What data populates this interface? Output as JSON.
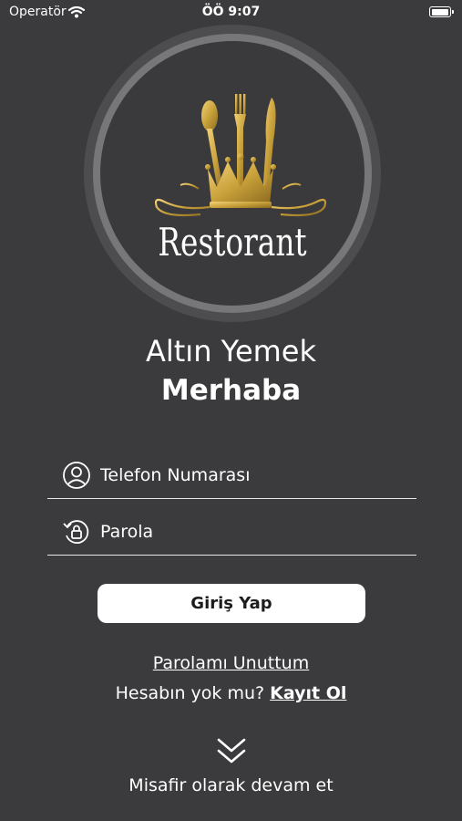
{
  "status_bar": {
    "carrier": "Operatör",
    "time": "ÖÖ 9:07",
    "battery_level": 0.95
  },
  "logo": {
    "word": "Restorant",
    "icon": "crown-cutlery-logo",
    "accent_color": "#c9a13a"
  },
  "header": {
    "app_name": "Altın Yemek",
    "greeting": "Merhaba"
  },
  "form": {
    "phone": {
      "placeholder": "Telefon Numarası",
      "value": "",
      "icon": "user-icon"
    },
    "password": {
      "placeholder": "Parola",
      "value": "",
      "icon": "lock-rotate-icon"
    },
    "login_label": "Giriş Yap"
  },
  "links": {
    "forgot_password": "Parolamı Unuttum",
    "no_account": "Hesabın yok mu?",
    "register": "Kayıt Ol",
    "guest": "Misafir olarak devam et",
    "guest_icon": "double-chevron-down-icon"
  }
}
